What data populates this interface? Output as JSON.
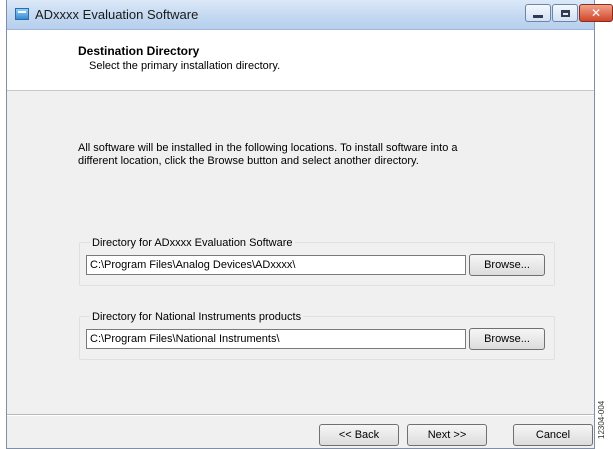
{
  "window": {
    "title": "ADxxxx Evaluation  Software"
  },
  "title_buttons": {
    "close": "✕"
  },
  "header": {
    "title": "Destination Directory",
    "subtitle": "Select the primary installation directory."
  },
  "intro_text": "All software will be installed in the following locations. To install software into a different location, click the Browse button and select another directory.",
  "groups": [
    {
      "label": "Directory for ADxxxx Evaluation  Software",
      "path": "C:\\Program Files\\Analog Devices\\ADxxxx\\",
      "browse_label": "Browse..."
    },
    {
      "label": "Directory for National Instruments products",
      "path": "C:\\Program Files\\National Instruments\\",
      "browse_label": "Browse..."
    }
  ],
  "footer": {
    "back_label": "<< Back",
    "next_label": "Next >>",
    "cancel_label": "Cancel"
  },
  "figure_code": "12304-004"
}
